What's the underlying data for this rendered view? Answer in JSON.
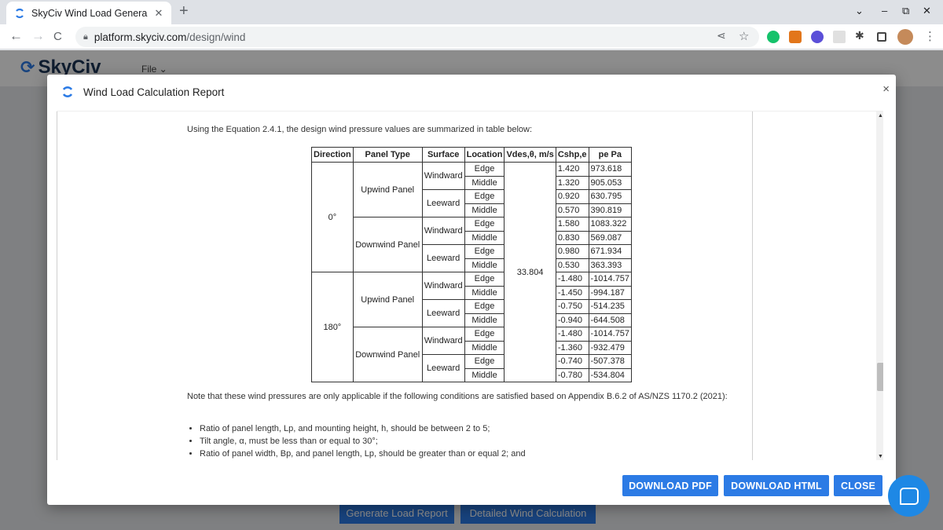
{
  "browser": {
    "tab_title": "SkyCiv Wind Load Genera",
    "tab_close": "✕",
    "new_tab": "+",
    "url_host": "platform.skyciv.com",
    "url_path": "/design/wind",
    "back": "←",
    "forward": "→",
    "reload": "C",
    "minimize": "–",
    "restore": "⧉",
    "close": "✕",
    "tab_menu": "⌄"
  },
  "app": {
    "logo": "SkyCiv",
    "file_menu": "File ⌄",
    "generate_report": "Generate Load Report",
    "detailed_calc": "Detailed Wind Calculation"
  },
  "modal": {
    "title": "Wind Load Calculation Report",
    "close": "×",
    "intro": "Using the Equation 2.4.1, the design wind pressure values are summarized in table below:",
    "table": {
      "headers": [
        "Direction",
        "Panel Type",
        "Surface",
        "Location",
        "Vdes,θ, m/s",
        "Cshp,e",
        "pe Pa"
      ],
      "velocity": "33.804",
      "directions": [
        "0°",
        "180°"
      ],
      "panel_types": [
        "Upwind Panel",
        "Downwind Panel"
      ],
      "surfaces": [
        "Windward",
        "Leeward"
      ],
      "locations": [
        "Edge",
        "Middle"
      ],
      "rows": [
        {
          "c": "1.420",
          "p": "973.618"
        },
        {
          "c": "1.320",
          "p": "905.053"
        },
        {
          "c": "0.920",
          "p": "630.795"
        },
        {
          "c": "0.570",
          "p": "390.819"
        },
        {
          "c": "1.580",
          "p": "1083.322"
        },
        {
          "c": "0.830",
          "p": "569.087"
        },
        {
          "c": "0.980",
          "p": "671.934"
        },
        {
          "c": "0.530",
          "p": "363.393"
        },
        {
          "c": "-1.480",
          "p": "-1014.757"
        },
        {
          "c": "-1.450",
          "p": "-994.187"
        },
        {
          "c": "-0.750",
          "p": "-514.235"
        },
        {
          "c": "-0.940",
          "p": "-644.508"
        },
        {
          "c": "-1.480",
          "p": "-1014.757"
        },
        {
          "c": "-1.360",
          "p": "-932.479"
        },
        {
          "c": "-0.740",
          "p": "-507.378"
        },
        {
          "c": "-0.780",
          "p": "-534.804"
        }
      ]
    },
    "note": "Note that these wind pressures are only applicable if the following conditions are satisfied based on Appendix B.6.2 of AS/NZS 1170.2 (2021):",
    "conditions": [
      "Ratio of panel length, Lp, and mounting height, h, should be between 2 to 5;",
      "Tilt angle, α, must be less than or equal to 30°;",
      "Ratio of panel width, Bp, and panel length, Lp, should be greater than or equal 2; and"
    ],
    "buttons": {
      "pdf": "DOWNLOAD PDF",
      "html": "DOWNLOAD HTML",
      "close": "CLOSE"
    }
  },
  "colors": {
    "accent": "#2c7be5",
    "chat": "#1e88e5"
  }
}
